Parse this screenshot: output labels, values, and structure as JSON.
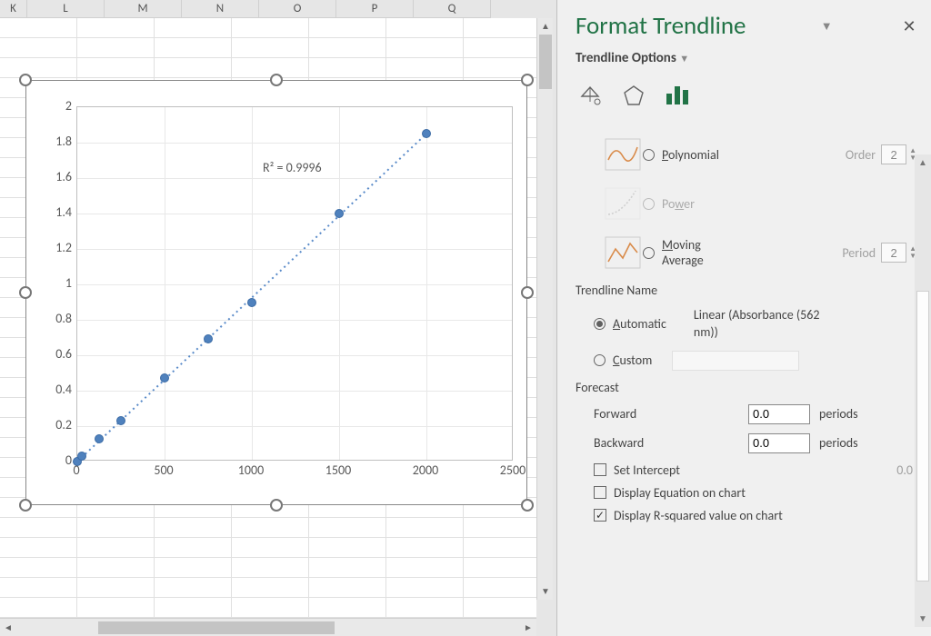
{
  "columns": [
    "K",
    "L",
    "M",
    "N",
    "O",
    "P",
    "Q"
  ],
  "pane": {
    "title": "Format Trendline",
    "subtitle": "Trendline Options",
    "type_polynomial": "Polynomial",
    "type_power": "Power",
    "type_moving": "Moving Average",
    "order_label": "Order",
    "order_value": "2",
    "period_label": "Period",
    "period_value": "2",
    "name_header": "Trendline Name",
    "name_auto": "Automatic",
    "name_auto_value": "Linear (Absorbance (562 nm))",
    "name_custom": "Custom",
    "forecast_header": "Forecast",
    "forward_label": "Forward",
    "forward_value": "0.0",
    "backward_label": "Backward",
    "backward_value": "0.0",
    "periods_unit": "periods",
    "set_intercept": "Set Intercept",
    "set_intercept_value": "0.0",
    "disp_eq": "Display Equation on chart",
    "disp_r2": "Display R-squared value on chart"
  },
  "chart_data": {
    "type": "scatter",
    "x": [
      0,
      25,
      125,
      250,
      500,
      750,
      1000,
      1500,
      2000
    ],
    "y": [
      0.0,
      0.03,
      0.13,
      0.23,
      0.47,
      0.69,
      0.9,
      1.4,
      1.85
    ],
    "trendline": "linear",
    "r2_label": "R² = 0.9996",
    "r2_value": 0.9996,
    "xlim": [
      0,
      2500
    ],
    "ylim": [
      0,
      2
    ],
    "xticks": [
      0,
      500,
      1000,
      1500,
      2000,
      2500
    ],
    "yticks": [
      0,
      0.2,
      0.4,
      0.6,
      0.8,
      1.0,
      1.2,
      1.4,
      1.6,
      1.8,
      2.0
    ],
    "title": "",
    "xlabel": "",
    "ylabel": ""
  }
}
